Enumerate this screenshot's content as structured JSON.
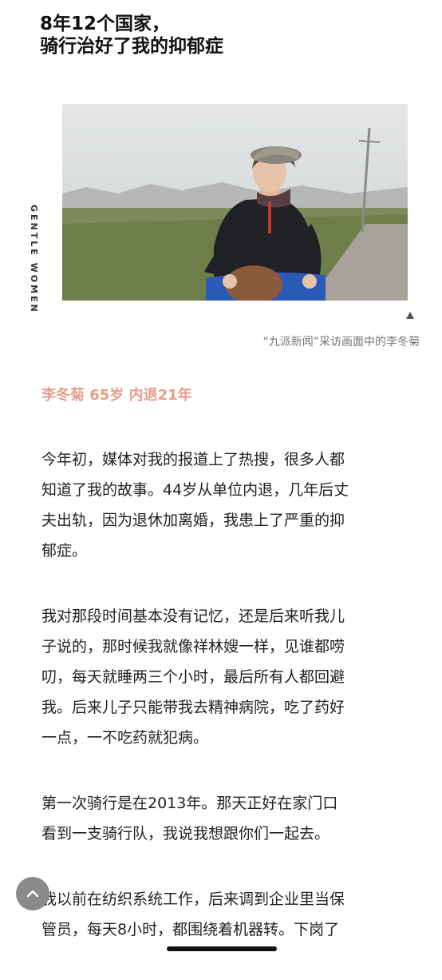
{
  "article": {
    "title": "8年12个国家，\n骑行治好了我的抑郁症",
    "side_label": "GENTLE WOMEN",
    "photo_caption": "“九派新闻”采访画面中的李冬菊",
    "subheading": "李冬菊 65岁 内退21年",
    "paragraphs": [
      "今年初，媒体对我的报道上了热搜，很多人都\n知道了我的故事。44岁从单位内退，几年后丈\n夫出轨，因为退休加离婚，我患上了严重的抑\n郁症。",
      "我对那段时间基本没有记忆，还是后来听我儿\n子说的，那时候我就像祥林嫂一样，见谁都唠\n叨，每天就睡两三个小时，最后所有人都回避\n我。后来儿子只能带我去精神病院，吃了药好\n一点，一不吃药就犯病。",
      "第一次骑行是在2013年。那天正好在家门口\n看到一支骑行队，我说我想跟你们一起去。",
      "我以前在纺织系统工作，后来调到企业里当保\n管员，每天8小时，都围绕着机器转。下岗了"
    ]
  },
  "icons": {
    "scroll_top": "chevron-up-icon",
    "caption_marker": "triangle-up-icon"
  },
  "colors": {
    "subheading": "#e4a08a",
    "scroll_button": "#8a8a8a"
  }
}
